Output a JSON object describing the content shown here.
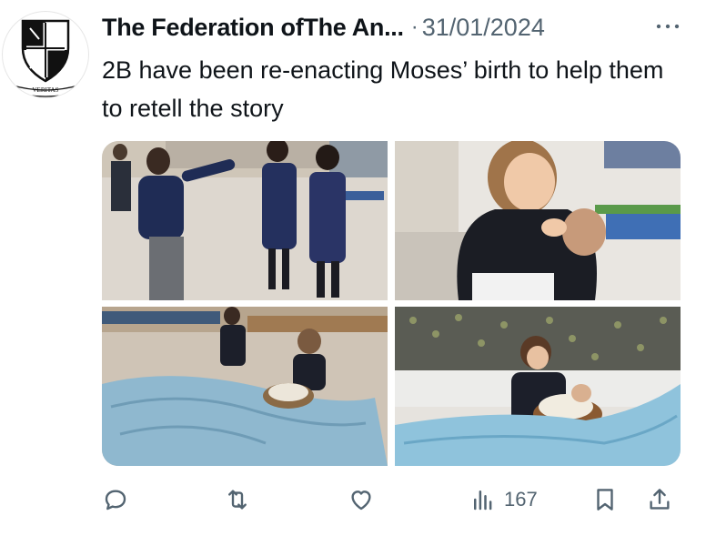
{
  "tweet": {
    "author_name": "The Federation ofThe An...",
    "separator": "·",
    "date": "31/01/2024",
    "text": "2B have been re-enacting Moses’ birth to help them to retell the story",
    "avatar_motto": "VERITAS"
  },
  "media": [
    {
      "label": "children-pointing"
    },
    {
      "label": "girl-holding-baby-doll"
    },
    {
      "label": "children-with-blue-cloth"
    },
    {
      "label": "basket-on-blue-river-cloth"
    }
  ],
  "actions": {
    "views": "167",
    "icons": [
      "reply-icon",
      "retweet-icon",
      "like-icon",
      "views-icon",
      "bookmark-icon",
      "share-icon"
    ]
  },
  "colors": {
    "text": "#0f1419",
    "secondary": "#536471",
    "background": "#ffffff"
  }
}
